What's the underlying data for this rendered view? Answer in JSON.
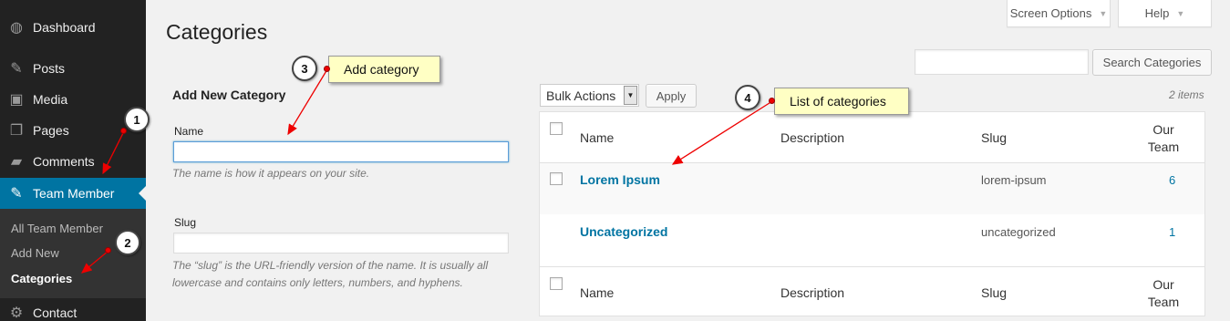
{
  "sidebar": {
    "items": [
      {
        "label": "Dashboard",
        "icon": "dashboard-icon"
      },
      {
        "label": "Posts",
        "icon": "pin-icon"
      },
      {
        "label": "Media",
        "icon": "media-icon"
      },
      {
        "label": "Pages",
        "icon": "pages-icon"
      },
      {
        "label": "Comments",
        "icon": "comment-icon"
      },
      {
        "label": "Team Member",
        "icon": "pin-icon",
        "active": true
      },
      {
        "label": "Contact",
        "icon": "gear-icon"
      }
    ],
    "submenu": [
      "All Team Member",
      "Add New",
      "Categories"
    ]
  },
  "header": {
    "title": "Categories",
    "screen_options": "Screen Options",
    "help": "Help"
  },
  "search": {
    "placeholder": "",
    "button": "Search Categories"
  },
  "form": {
    "heading": "Add New Category",
    "name_label": "Name",
    "name_help": "The name is how it appears on your site.",
    "slug_label": "Slug",
    "slug_help": "The “slug” is the URL-friendly version of the name. It is usually all lowercase and contains only letters, numbers, and hyphens."
  },
  "list": {
    "bulk_action": "Bulk Actions",
    "apply": "Apply",
    "count": "2 items",
    "columns": [
      "Name",
      "Description",
      "Slug",
      "Our Team"
    ],
    "rows": [
      {
        "name": "Lorem Ipsum",
        "description": "",
        "slug": "lorem-ipsum",
        "count": "6"
      },
      {
        "name": "Uncategorized",
        "description": "",
        "slug": "uncategorized",
        "count": "1"
      }
    ]
  },
  "annotations": [
    {
      "number": "1"
    },
    {
      "number": "2"
    },
    {
      "number": "3",
      "label": "Add category"
    },
    {
      "number": "4",
      "label": "List of categories"
    }
  ],
  "colors": {
    "sidebar": "#222222",
    "active": "#0074a2",
    "link": "#0074a2",
    "callout": "#ffffc4"
  }
}
